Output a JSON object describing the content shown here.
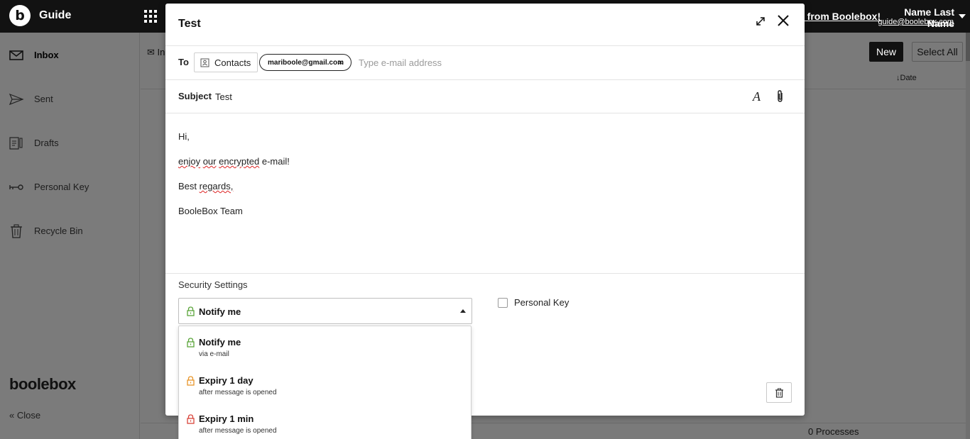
{
  "topbar": {
    "logo_letter": "b",
    "app_name": "Guide",
    "promo_text": "s from Boolebox!",
    "user_name": "Name Last Name",
    "user_email": "guide@boolebox.com"
  },
  "sidebar": {
    "items": [
      {
        "label": "Inbox",
        "icon": "envelope-icon",
        "active": true
      },
      {
        "label": "Sent",
        "icon": "paper-plane-icon",
        "active": false
      },
      {
        "label": "Drafts",
        "icon": "drafts-icon",
        "active": false
      },
      {
        "label": "Personal Key",
        "icon": "key-icon",
        "active": false
      },
      {
        "label": "Recycle Bin",
        "icon": "trash-icon",
        "active": false
      }
    ],
    "brand": "boolebox",
    "close_label": "Close"
  },
  "main": {
    "tab_label": "In",
    "new_button": "New",
    "select_all_button": "Select All",
    "sort_column": "Date",
    "processes_text": "0 Processes"
  },
  "compose": {
    "title": "Test",
    "to_label": "To",
    "contacts_button": "Contacts",
    "recipient_chip": "mariboole@gmail.com",
    "chip_remove": "×",
    "email_placeholder": "Type e-mail address",
    "subject_label": "Subject",
    "subject_value": "Test",
    "body": {
      "greeting": "Hi,",
      "line1_a": "enjoy",
      "line1_b": "our",
      "line1_c": "encrypted",
      "line1_d": "e-mail!",
      "line2_a": "Best",
      "line2_b": "regards,",
      "signature": "BooleBox Team"
    },
    "security_settings_label": "Security Settings",
    "security_selected": "Notify me",
    "personal_key_label": "Personal Key",
    "personal_key_checked": false
  },
  "dropdown": {
    "options": [
      {
        "title": "Notify me",
        "subtitle": "via e-mail",
        "lock_color": "#5aa53a"
      },
      {
        "title": "Expiry 1 day",
        "subtitle": "after message is opened",
        "lock_color": "#e8952a"
      },
      {
        "title": "Expiry 1 min",
        "subtitle": "after message is opened",
        "lock_color": "#d9443a"
      }
    ]
  },
  "colors": {
    "topbar_bg": "#121212",
    "overlay_bg": "#7a7a7a",
    "modal_bg": "#ffffff"
  }
}
